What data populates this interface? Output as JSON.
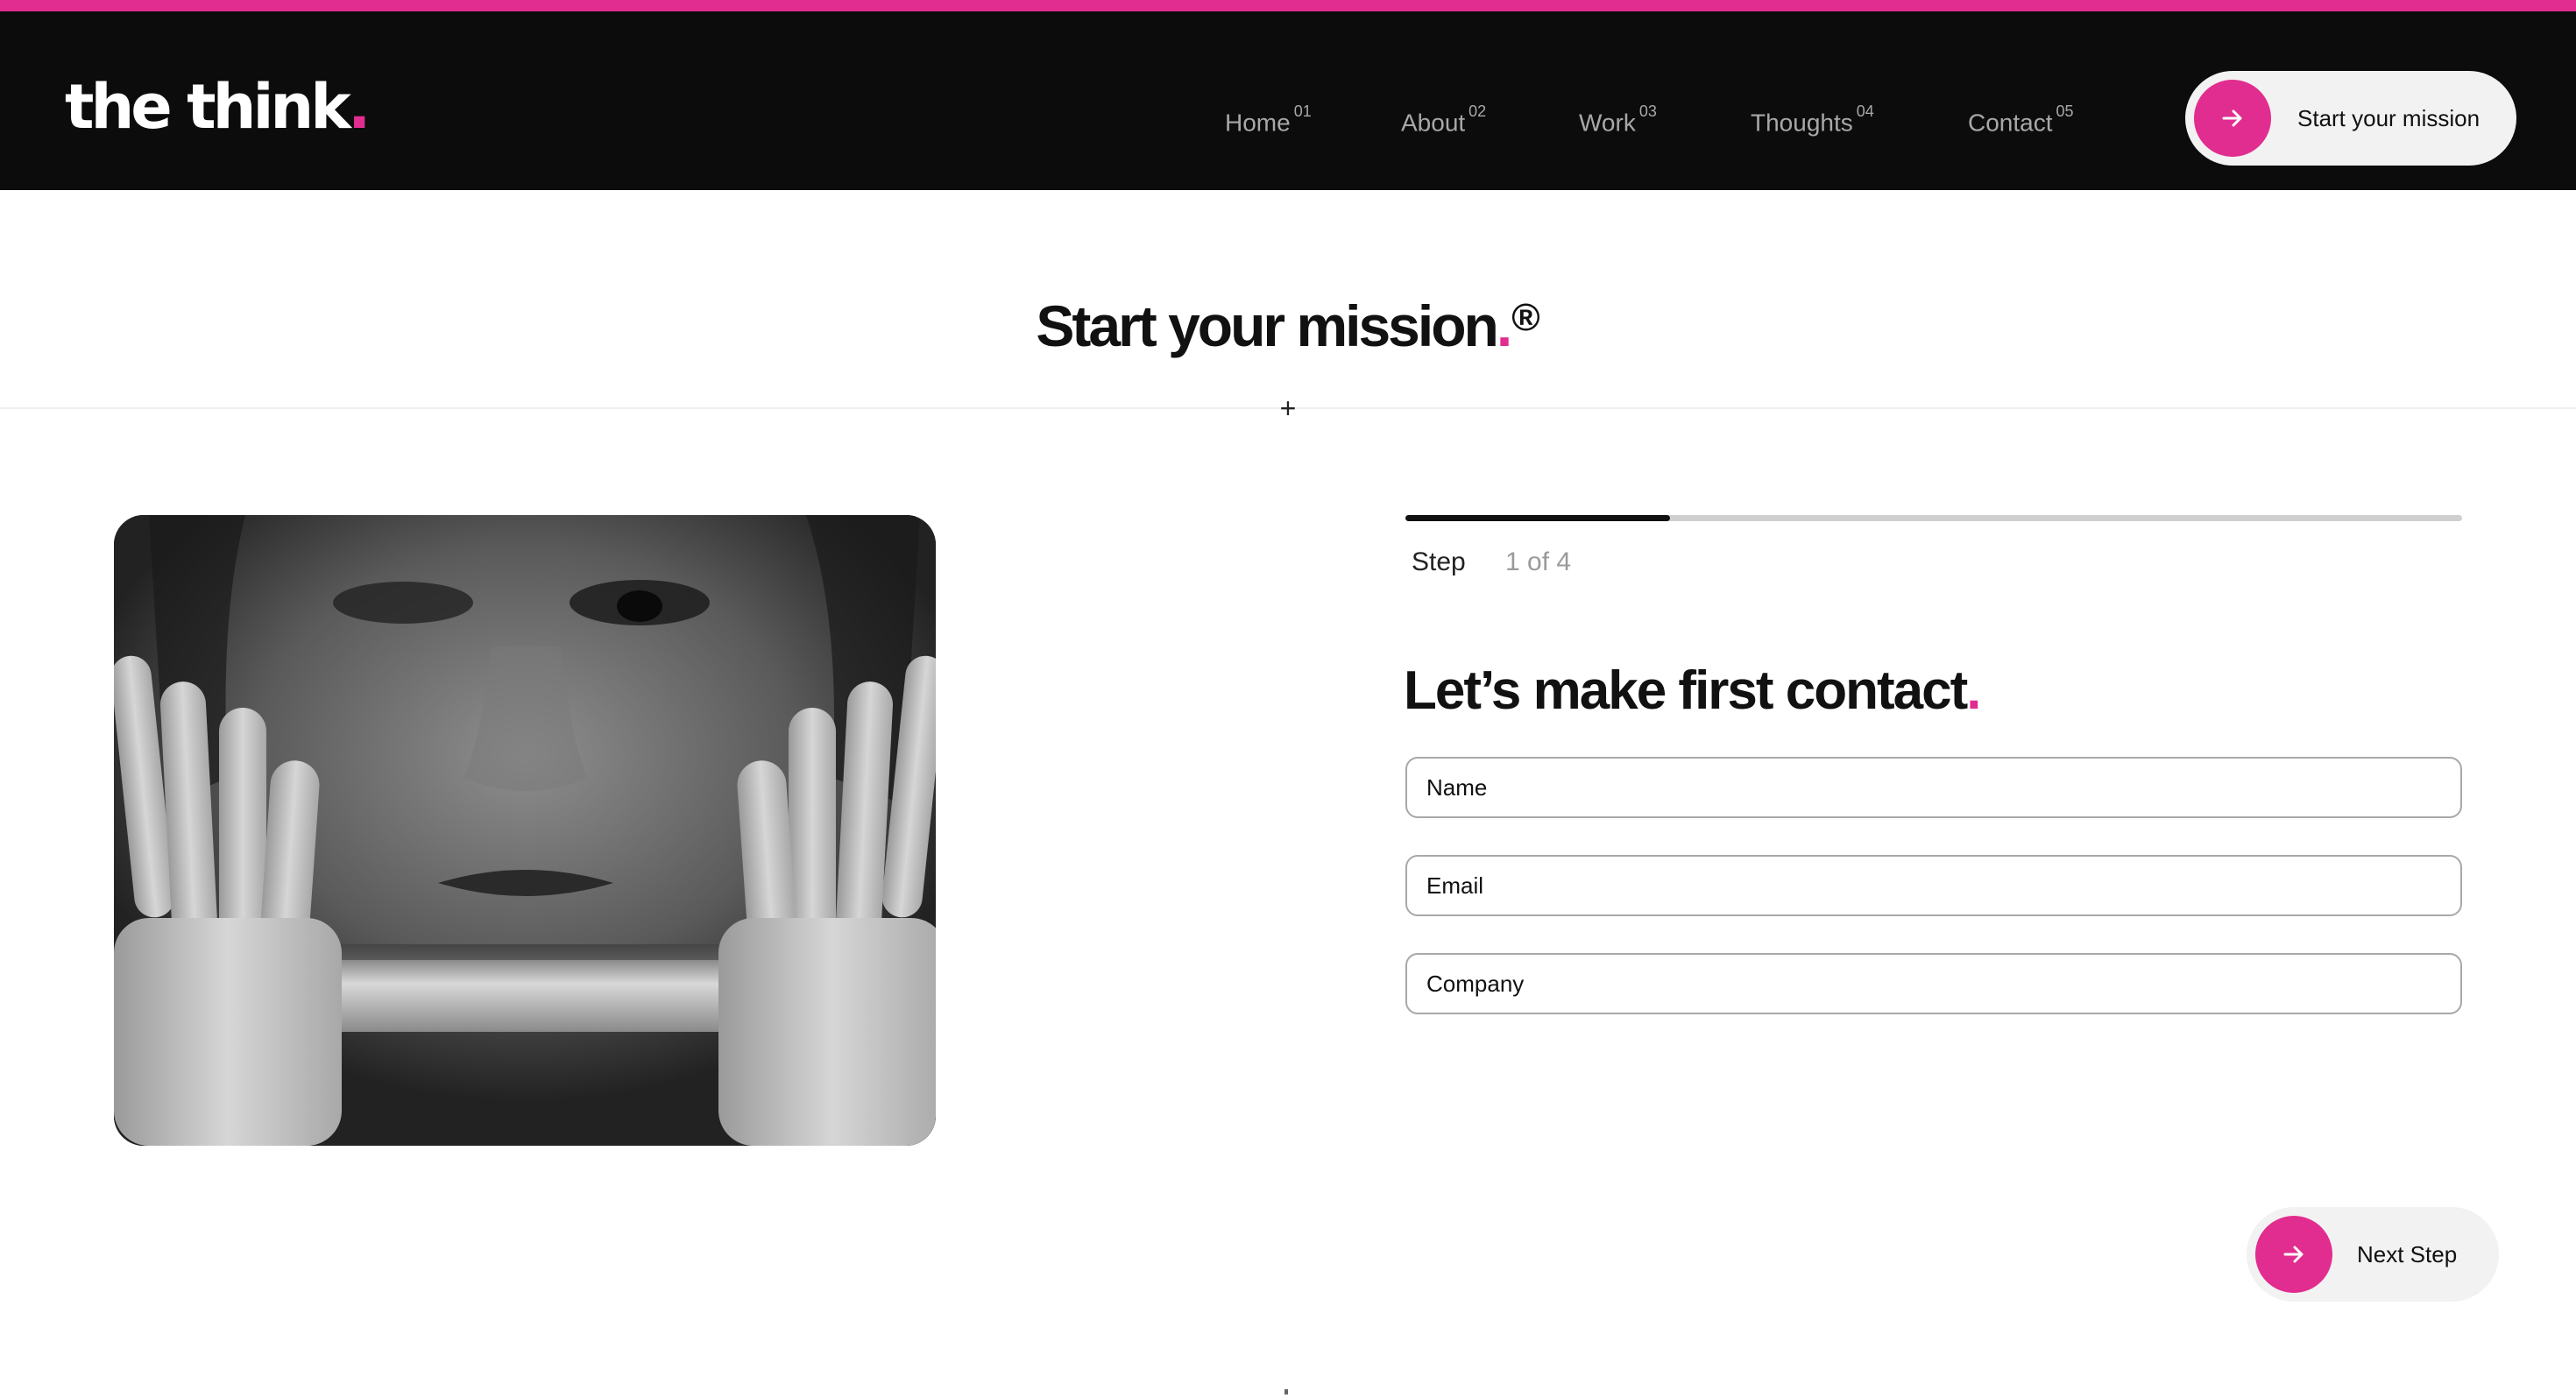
{
  "header": {
    "logo_text": "the think",
    "logo_dot": ".",
    "nav": [
      {
        "label": "Home",
        "num": "01"
      },
      {
        "label": "About",
        "num": "02"
      },
      {
        "label": "Work",
        "num": "03"
      },
      {
        "label": "Thoughts",
        "num": "04"
      },
      {
        "label": "Contact",
        "num": "05"
      }
    ],
    "cta_label": "Start your mission"
  },
  "hero": {
    "title": "Start your mission",
    "title_dot": ".",
    "title_mark": "®",
    "divider_symbol": "+"
  },
  "form": {
    "progress_fraction": 0.25,
    "step_label": "Step",
    "step_count": "1 of 4",
    "title": "Let’s make first contact",
    "title_dot": ".",
    "fields": [
      {
        "placeholder": "Name",
        "value": ""
      },
      {
        "placeholder": "Email",
        "value": ""
      },
      {
        "placeholder": "Company",
        "value": ""
      }
    ],
    "next_label": "Next Step"
  },
  "image": {
    "subject": "black-and-white photo of a woman wearing an astronaut helmet, hands on the glass"
  },
  "colors": {
    "accent": "#e12d8f",
    "header_bg": "#0c0c0c",
    "nav_text": "#a8a8a8",
    "button_bg": "#f2f2f2"
  },
  "icons": {
    "cta_icon": "arrow-right-icon",
    "next_icon": "arrow-right-icon"
  }
}
